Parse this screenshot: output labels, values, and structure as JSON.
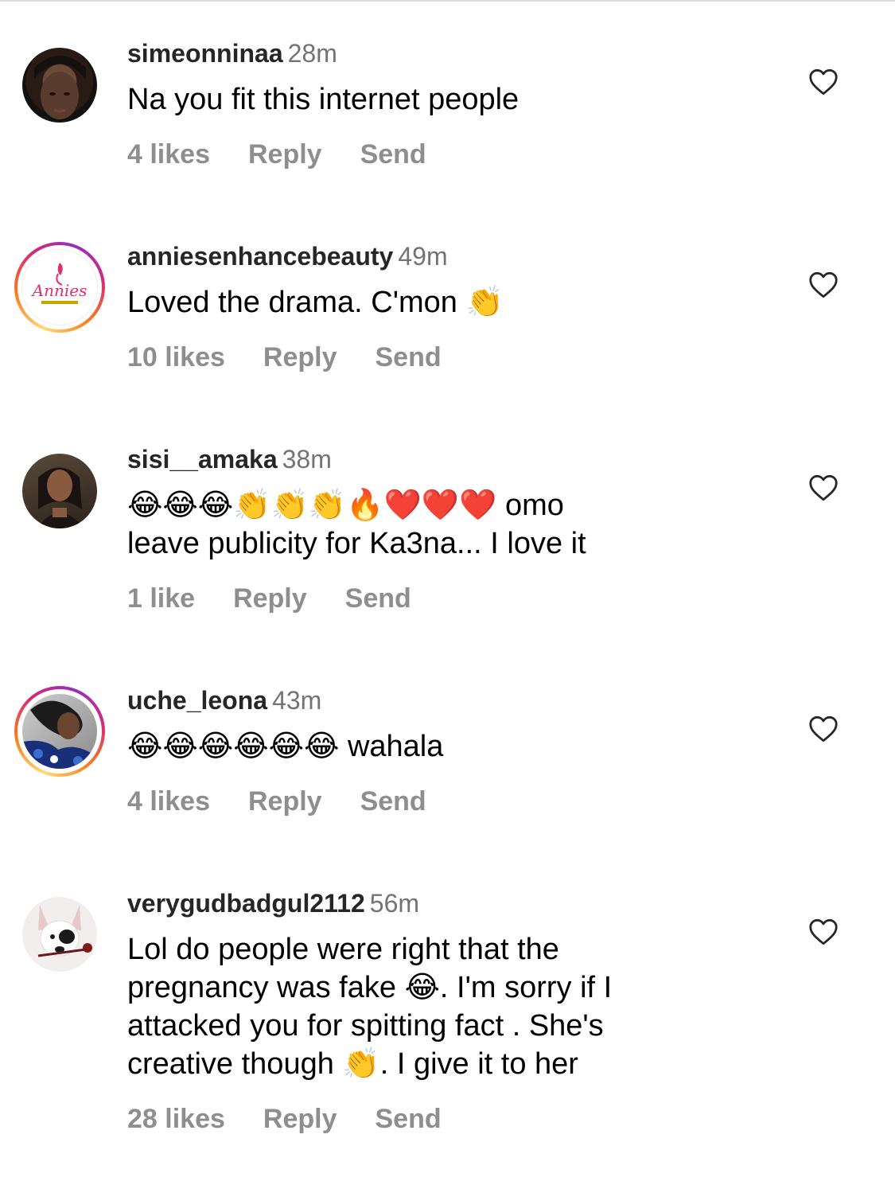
{
  "comments": [
    {
      "username": "simeonninaa",
      "time": "28m",
      "text": "Na you fit this internet people",
      "likes": "4 likes",
      "reply": "Reply",
      "send": "Send",
      "story_ring": false
    },
    {
      "username": "anniesenhancebeauty",
      "time": "49m",
      "text": "Loved the drama. C'mon 👏",
      "likes": "10 likes",
      "reply": "Reply",
      "send": "Send",
      "story_ring": true,
      "avatar_logo_text": "Annies"
    },
    {
      "username": "sisi__amaka",
      "time": "38m",
      "text_line1": "😂😂😂👏👏👏🔥❤️❤️❤️ omo",
      "text_line2": "leave publicity for Ka3na... I love it",
      "likes": "1 like",
      "reply": "Reply",
      "send": "Send",
      "story_ring": false
    },
    {
      "username": "uche_leona",
      "time": "43m",
      "text": "😂😂😂😂😂😂 wahala",
      "likes": "4 likes",
      "reply": "Reply",
      "send": "Send",
      "story_ring": true
    },
    {
      "username": "verygudbadgul2112",
      "time": "56m",
      "text_lines": [
        "Lol do people were right that the",
        "pregnancy was fake 😂. I'm sorry if I",
        "attacked you for spitting fact . She's",
        "creative though 👏. I give it to her"
      ],
      "likes": "28 likes",
      "reply": "Reply",
      "send": "Send",
      "story_ring": false
    }
  ],
  "colors": {
    "username": "#262626",
    "meta": "#737373",
    "actions": "#8e8e8e",
    "heart": "#262626"
  },
  "icons": [
    "heart-outline-icon"
  ]
}
